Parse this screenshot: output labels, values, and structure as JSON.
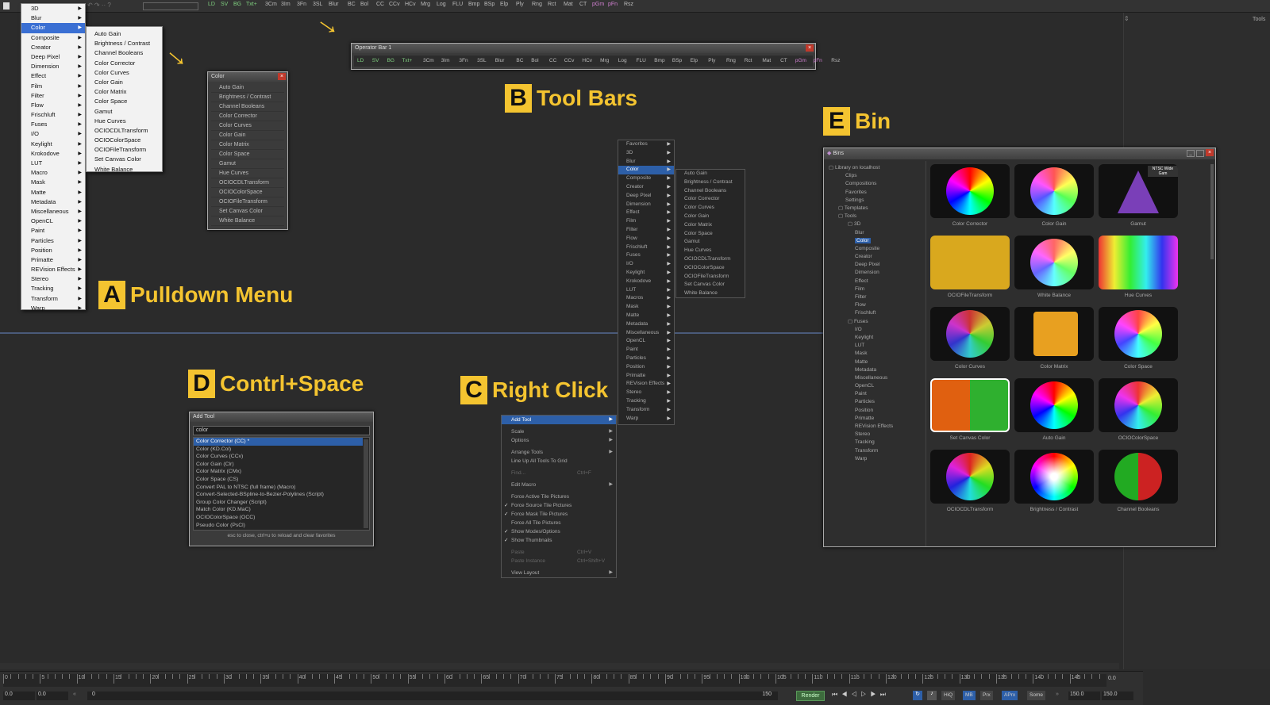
{
  "topbar": {
    "tools": [
      "LD",
      "SV",
      "BG",
      "Txt+",
      "3Cm",
      "3Im",
      "3Fn",
      "3SL",
      "Blur",
      "BC",
      "Bol",
      "CC",
      "CCv",
      "HCv",
      "Mrg",
      "Log",
      "FLU",
      "Bmp",
      "BSp",
      "Elp",
      "Ply",
      "Rng",
      "Rct",
      "Mat",
      "CT",
      "pGm",
      "pFn",
      "Rsz"
    ]
  },
  "sidebar": {
    "label": "Tools"
  },
  "pulldown": {
    "items": [
      "3D",
      "Blur",
      "Color",
      "Composite",
      "Creator",
      "Deep Pixel",
      "Dimension",
      "Effect",
      "Film",
      "Filter",
      "Flow",
      "Frischluft",
      "Fuses",
      "I/O",
      "Keylight",
      "Krokodove",
      "LUT",
      "Macro",
      "Mask",
      "Matte",
      "Metadata",
      "Miscellaneous",
      "OpenCL",
      "Paint",
      "Particles",
      "Position",
      "Primatte",
      "REVision Effects",
      "Stereo",
      "Tracking",
      "Transform",
      "Warp"
    ],
    "selected_index": 2,
    "submenu": [
      "Auto Gain",
      "Brightness / Contrast",
      "Channel Booleans",
      "Color Corrector",
      "Color Curves",
      "Color Gain",
      "Color Matrix",
      "Color Space",
      "Gamut",
      "Hue Curves",
      "OCIOCDLTransform",
      "OCIOColorSpace",
      "OCIOFileTransform",
      "Set Canvas Color",
      "White Balance"
    ]
  },
  "color_toolbar": {
    "title": "Color",
    "items": [
      "Auto Gain",
      "Brightness / Contrast",
      "Channel Booleans",
      "Color Corrector",
      "Color Curves",
      "Color Gain",
      "Color Matrix",
      "Color Space",
      "Gamut",
      "Hue Curves",
      "OCIOCDLTransform",
      "OCIOColorSpace",
      "OCIOFileTransform",
      "Set Canvas Color",
      "White Balance"
    ]
  },
  "operator_bar": {
    "title": "Operator Bar 1",
    "items": [
      "LD",
      "SV",
      "BG",
      "Txt+",
      "3Cm",
      "3Im",
      "3Fn",
      "3SL",
      "Blur",
      "BC",
      "Bol",
      "CC",
      "CCv",
      "HCv",
      "Mrg",
      "Log",
      "FLU",
      "Bmp",
      "BSp",
      "Elp",
      "Ply",
      "Rng",
      "Rct",
      "Mat",
      "CT",
      "pGm",
      "pFn",
      "Rsz"
    ]
  },
  "callouts": {
    "a": {
      "letter": "A",
      "text": "Pulldown Menu"
    },
    "b": {
      "letter": "B",
      "text": "Tool Bars"
    },
    "c": {
      "letter": "C",
      "text": "Right Click"
    },
    "d": {
      "letter": "D",
      "text": "Contrl+Space"
    },
    "e": {
      "letter": "E",
      "text": "Bin"
    }
  },
  "add_tool": {
    "title": "Add Tool",
    "search_value": "color",
    "results": [
      "Color Corrector (CC) *",
      "Color (KD.Col)",
      "Color Curves (CCv)",
      "Color Gain (Clr)",
      "Color Matrix (CMx)",
      "Color Space (CS)",
      "Convert PAL to NTSC (full frame) (Macro)",
      "Convert-Selected-BSpline-to-Bezier-Polylines (Script)",
      "Group Color Changer (Script)",
      "Match Color (KD.MaC)",
      "OCIOColorSpace (OCC)",
      "Pseudo Color (PsCl)"
    ],
    "selected_index": 0,
    "footer": "esc to close, ctrl+u to reload and clear favorites"
  },
  "context_menu": {
    "items": [
      {
        "label": "Add Tool",
        "arrow": true,
        "sel": true
      },
      {
        "sep": true
      },
      {
        "label": "Scale",
        "arrow": true
      },
      {
        "label": "Options",
        "arrow": true
      },
      {
        "sep": true
      },
      {
        "label": "Arrange Tools",
        "arrow": true
      },
      {
        "label": "Line Up All Tools To Grid"
      },
      {
        "sep": true
      },
      {
        "label": "Find...",
        "shortcut": "Ctrl+F",
        "dis": true
      },
      {
        "sep": true
      },
      {
        "label": "Edit Macro",
        "arrow": true
      },
      {
        "sep": true
      },
      {
        "label": "Force Active Tile Pictures"
      },
      {
        "label": "Force Source Tile Pictures",
        "check": true
      },
      {
        "label": "Force Mask Tile Pictures",
        "check": true
      },
      {
        "label": "Force All Tile Pictures"
      },
      {
        "label": "Show Modes/Options",
        "check": true
      },
      {
        "label": "Show Thumbnails",
        "check": true
      },
      {
        "sep": true
      },
      {
        "label": "Paste",
        "shortcut": "Ctrl+V",
        "dis": true
      },
      {
        "label": "Paste Instance",
        "shortcut": "Ctrl+Shift+V",
        "dis": true
      },
      {
        "sep": true
      },
      {
        "label": "View Layout",
        "arrow": true
      }
    ]
  },
  "context_sub1": {
    "items": [
      "Favorites",
      "3D",
      "Blur",
      "Color",
      "Composite",
      "Creator",
      "Deep Pixel",
      "Dimension",
      "Effect",
      "Film",
      "Filter",
      "Flow",
      "Frischluft",
      "Fuses",
      "I/O",
      "Keylight",
      "Krokodove",
      "LUT",
      "Macros",
      "Mask",
      "Matte",
      "Metadata",
      "Miscellaneous",
      "OpenCL",
      "Paint",
      "Particles",
      "Position",
      "Primatte",
      "REVision Effects",
      "Stereo",
      "Tracking",
      "Transform",
      "Warp"
    ],
    "selected_index": 3
  },
  "context_sub2": {
    "items": [
      "Auto Gain",
      "Brightness / Contrast",
      "Channel Booleans",
      "Color Corrector",
      "Color Curves",
      "Color Gain",
      "Color Matrix",
      "Color Space",
      "Gamut",
      "Hue Curves",
      "OCIOCDLTransform",
      "OCIOColorSpace",
      "OCIOFileTransform",
      "Set Canvas Color",
      "White Balance"
    ]
  },
  "bins": {
    "title": "Bins",
    "tree": [
      {
        "label": "Library on localhost",
        "depth": 0,
        "box": true
      },
      {
        "label": "Clips",
        "depth": 1
      },
      {
        "label": "Compositions",
        "depth": 1
      },
      {
        "label": "Favorites",
        "depth": 1
      },
      {
        "label": "Settings",
        "depth": 1
      },
      {
        "label": "Templates",
        "depth": 1,
        "box": true
      },
      {
        "label": "Tools",
        "depth": 1,
        "box": true
      },
      {
        "label": "3D",
        "depth": 2,
        "box": true
      },
      {
        "label": "Blur",
        "depth": 2
      },
      {
        "label": "Color",
        "depth": 2,
        "sel": true
      },
      {
        "label": "Composite",
        "depth": 2
      },
      {
        "label": "Creator",
        "depth": 2
      },
      {
        "label": "Deep Pixel",
        "depth": 2
      },
      {
        "label": "Dimension",
        "depth": 2
      },
      {
        "label": "Effect",
        "depth": 2
      },
      {
        "label": "Film",
        "depth": 2
      },
      {
        "label": "Filter",
        "depth": 2
      },
      {
        "label": "Flow",
        "depth": 2
      },
      {
        "label": "Frischluft",
        "depth": 2
      },
      {
        "label": "Fuses",
        "depth": 2,
        "box": true
      },
      {
        "label": "I/O",
        "depth": 2
      },
      {
        "label": "Keylight",
        "depth": 2
      },
      {
        "label": "LUT",
        "depth": 2
      },
      {
        "label": "Mask",
        "depth": 2
      },
      {
        "label": "Matte",
        "depth": 2
      },
      {
        "label": "Metadata",
        "depth": 2
      },
      {
        "label": "Miscellaneous",
        "depth": 2
      },
      {
        "label": "OpenCL",
        "depth": 2
      },
      {
        "label": "Paint",
        "depth": 2
      },
      {
        "label": "Particles",
        "depth": 2
      },
      {
        "label": "Position",
        "depth": 2
      },
      {
        "label": "Primatte",
        "depth": 2
      },
      {
        "label": "REVision Effects",
        "depth": 2
      },
      {
        "label": "Stereo",
        "depth": 2
      },
      {
        "label": "Tracking",
        "depth": 2
      },
      {
        "label": "Transform",
        "depth": 2
      },
      {
        "label": "Warp",
        "depth": 2
      }
    ],
    "gamut_badge": "NTSC Wide Gam",
    "items": [
      {
        "label": "Color Corrector",
        "icon": "color-wheel-icon"
      },
      {
        "label": "Color Gain",
        "icon": "gain-sliders-icon"
      },
      {
        "label": "Gamut",
        "icon": "gamut-triangle-icon"
      },
      {
        "label": "OCIOFileTransform",
        "icon": "ocio-folder-icon"
      },
      {
        "label": "White Balance",
        "icon": "eyedropper-wheel-icon"
      },
      {
        "label": "Hue Curves",
        "icon": "hue-curves-icon"
      },
      {
        "label": "Color Curves",
        "icon": "color-curves-icon"
      },
      {
        "label": "Color Matrix",
        "icon": "matrix-grid-icon"
      },
      {
        "label": "Color Space",
        "icon": "color-space-icon"
      },
      {
        "label": "Set Canvas Color",
        "icon": "canvas-color-icon"
      },
      {
        "label": "Auto Gain",
        "icon": "auto-gain-icon"
      },
      {
        "label": "OCIOColorSpace",
        "icon": "ocio-colorspace-icon"
      },
      {
        "label": "OCIOCDLTransform",
        "icon": "ocio-cdl-icon"
      },
      {
        "label": "Brightness / Contrast",
        "icon": "brightness-icon"
      },
      {
        "label": "Channel Booleans",
        "icon": "channel-booleans-icon"
      }
    ]
  },
  "timeline": {
    "ticks": [
      "0",
      "5",
      "10",
      "15",
      "20",
      "25",
      "30",
      "35",
      "40",
      "45",
      "50",
      "55",
      "60",
      "65",
      "70",
      "75",
      "80",
      "85",
      "90",
      "95",
      "100",
      "105",
      "110",
      "115",
      "120",
      "125",
      "130",
      "135",
      "140",
      "145"
    ],
    "right_value": "0.0",
    "start": "0.0",
    "start2": "0.0",
    "current": "0",
    "end_field": "150",
    "render_label": "Render",
    "modes": [
      "HiQ",
      "MB",
      "Prx",
      "APrx",
      "Some"
    ],
    "end": "150.0",
    "end2": "150.0"
  }
}
